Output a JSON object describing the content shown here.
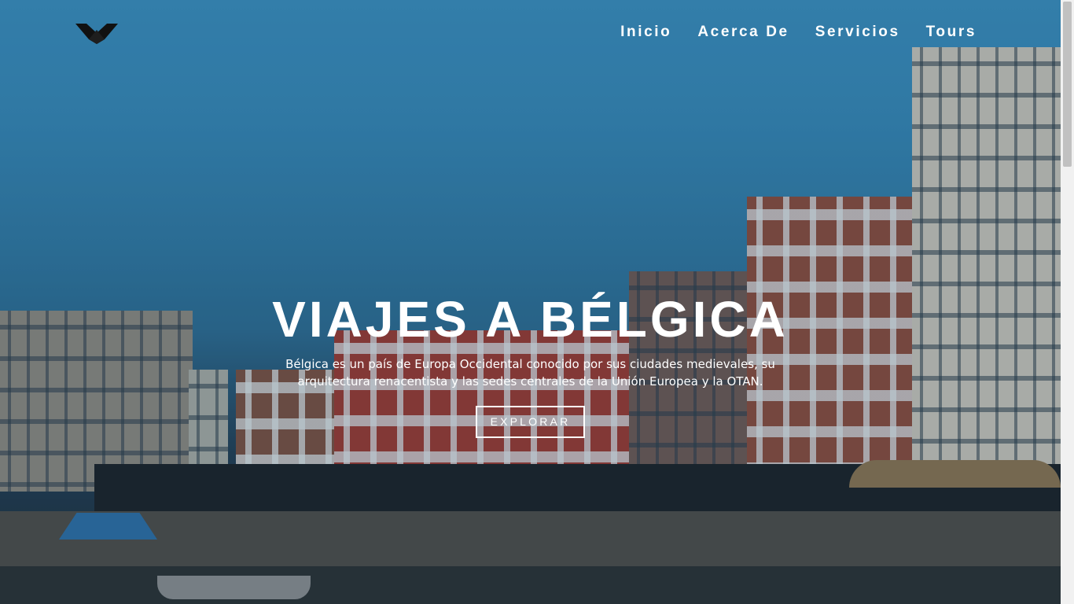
{
  "nav": {
    "logo_icon": "mountain-logo-icon",
    "items": [
      {
        "label": "Inicio"
      },
      {
        "label": "Acerca De"
      },
      {
        "label": "Servicios"
      },
      {
        "label": "Tours"
      }
    ]
  },
  "hero": {
    "title": "VIAJES A BÉLGICA",
    "description": "Bélgica es un país de Europa Occidental conocido por sus ciudades medievales, su arquitectura renacentista y las sedes centrales de la Unión Europea y la OTAN.",
    "button_label": "EXPLORAR"
  },
  "colors": {
    "sky": "#3588b8",
    "overlay": "#1e4a66",
    "text": "#ffffff"
  }
}
